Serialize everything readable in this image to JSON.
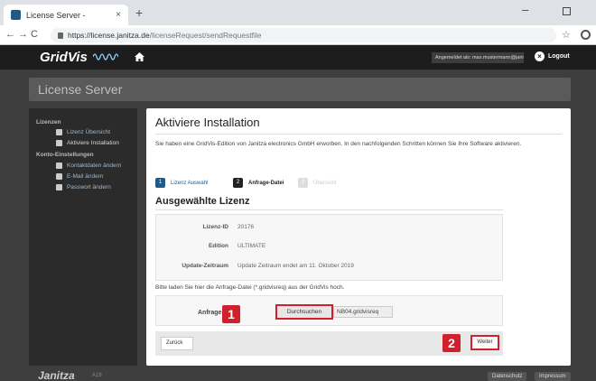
{
  "browser": {
    "tab_title": "License Server -",
    "tab_close": "×",
    "new_tab": "+",
    "url_host": "https://license.janitza.de",
    "url_path": "/licenseRequest/sendRequestfile",
    "minimize": "–"
  },
  "header": {
    "brand": "GridVis",
    "login_info": "Angemeldet als: max.mustermann@janitza.de",
    "logout_label": "Logout"
  },
  "page_title": "License Server",
  "sidebar": {
    "section_licenses": "Lizenzen",
    "items_licenses": [
      {
        "label": "Lizenz Übersicht",
        "icon": "list-icon"
      },
      {
        "label": "Aktiviere Installation",
        "icon": "check-icon"
      }
    ],
    "section_account": "Konto-Einstellungen",
    "items_account": [
      {
        "label": "Kontaktdaten ändern",
        "icon": "user-icon"
      },
      {
        "label": "E-Mail ändern",
        "icon": "user-icon"
      },
      {
        "label": "Passwort ändern",
        "icon": "lock-icon"
      }
    ]
  },
  "main": {
    "title": "Aktiviere Installation",
    "intro": "Sie haben eine GridVis-Edition von Janitza electronics GmbH erworben. In den nachfolgenden Schritten können Sie Ihre Software aktivieren.",
    "steps": [
      {
        "num": "1",
        "label": "Lizenz Auswahl"
      },
      {
        "num": "2",
        "label": "Anfrage-Datei"
      },
      {
        "num": "3",
        "label": "Übersicht"
      }
    ],
    "section_title": "Ausgewählte Lizenz",
    "license": {
      "id_label": "Lizenz-ID",
      "id_value": "20176",
      "edition_label": "Edition",
      "edition_value": "ULTIMATE",
      "period_label": "Update-Zeitraum",
      "period_value": "Update Zeitraum endet am 11. Oktober 2019"
    },
    "upload_note": "Bitte laden Sie hier die Anfrage-Datei (*.gridvisreq) aus der GridVis hoch.",
    "upload_label": "Anfrage",
    "browse_label": "Durchsuchen",
    "file_name": "NB04.gridvisreq",
    "back_label": "Zurück",
    "next_label": "Weiter"
  },
  "markers": [
    "1",
    "2"
  ],
  "footer": {
    "logo": "Janitza",
    "version": "A18",
    "privacy": "Datenschutz",
    "imprint": "Impressum"
  },
  "colors": {
    "accent_red": "#d0202e",
    "header_bg": "#1d1d1d",
    "page_bg": "#3e3e3e"
  }
}
